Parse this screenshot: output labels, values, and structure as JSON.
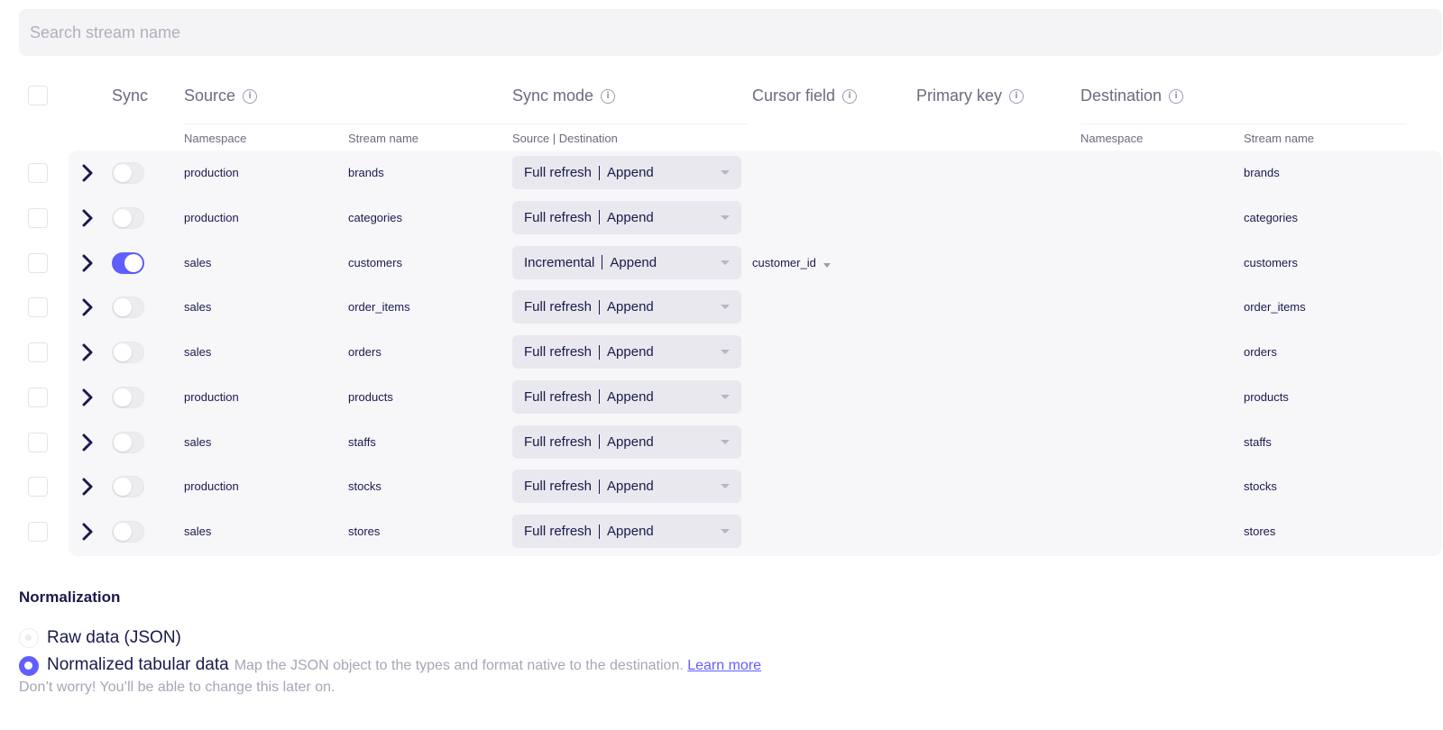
{
  "search": {
    "placeholder": "Search stream name"
  },
  "header": {
    "sync": "Sync",
    "source": "Source",
    "sync_mode": "Sync mode",
    "cursor_field": "Cursor field",
    "primary_key": "Primary key",
    "destination": "Destination",
    "sub": {
      "source_namespace": "Namespace",
      "source_stream": "Stream name",
      "sync_mode": "Source | Destination",
      "dest_namespace": "Namespace",
      "dest_stream": "Stream name"
    }
  },
  "rows": [
    {
      "enabled": false,
      "namespace": "production",
      "stream": "brands",
      "source_mode": "Full refresh",
      "dest_mode": "Append",
      "cursor": "",
      "primary_key": "",
      "dest_namespace": "",
      "dest_stream": "brands"
    },
    {
      "enabled": false,
      "namespace": "production",
      "stream": "categories",
      "source_mode": "Full refresh",
      "dest_mode": "Append",
      "cursor": "",
      "primary_key": "",
      "dest_namespace": "",
      "dest_stream": "categories"
    },
    {
      "enabled": true,
      "namespace": "sales",
      "stream": "customers",
      "source_mode": "Incremental",
      "dest_mode": "Append",
      "cursor": "customer_id",
      "primary_key": "",
      "dest_namespace": "",
      "dest_stream": "customers"
    },
    {
      "enabled": false,
      "namespace": "sales",
      "stream": "order_items",
      "source_mode": "Full refresh",
      "dest_mode": "Append",
      "cursor": "",
      "primary_key": "",
      "dest_namespace": "",
      "dest_stream": "order_items"
    },
    {
      "enabled": false,
      "namespace": "sales",
      "stream": "orders",
      "source_mode": "Full refresh",
      "dest_mode": "Append",
      "cursor": "",
      "primary_key": "",
      "dest_namespace": "",
      "dest_stream": "orders"
    },
    {
      "enabled": false,
      "namespace": "production",
      "stream": "products",
      "source_mode": "Full refresh",
      "dest_mode": "Append",
      "cursor": "",
      "primary_key": "",
      "dest_namespace": "",
      "dest_stream": "products"
    },
    {
      "enabled": false,
      "namespace": "sales",
      "stream": "staffs",
      "source_mode": "Full refresh",
      "dest_mode": "Append",
      "cursor": "",
      "primary_key": "",
      "dest_namespace": "",
      "dest_stream": "staffs"
    },
    {
      "enabled": false,
      "namespace": "production",
      "stream": "stocks",
      "source_mode": "Full refresh",
      "dest_mode": "Append",
      "cursor": "",
      "primary_key": "",
      "dest_namespace": "",
      "dest_stream": "stocks"
    },
    {
      "enabled": false,
      "namespace": "sales",
      "stream": "stores",
      "source_mode": "Full refresh",
      "dest_mode": "Append",
      "cursor": "",
      "primary_key": "",
      "dest_namespace": "",
      "dest_stream": "stores"
    }
  ],
  "normalization": {
    "title": "Normalization",
    "options": [
      {
        "label": "Raw data (JSON)",
        "selected": false,
        "description": ""
      },
      {
        "label": "Normalized tabular data",
        "selected": true,
        "description": "Map the JSON object to the types and format native to the destination.",
        "link": "Learn more"
      }
    ],
    "hint": "Don’t worry! You’ll be able to change this later on."
  },
  "colors": {
    "accent": "#615eff",
    "text": "#1a194d",
    "muted": "#6b6b80",
    "row_bg": "#f7f7fa",
    "dropdown_bg": "#e8e8ee"
  },
  "icons": {
    "info": "info-circle-icon",
    "expand": "chevron-right-icon",
    "caret": "caret-down-icon"
  }
}
